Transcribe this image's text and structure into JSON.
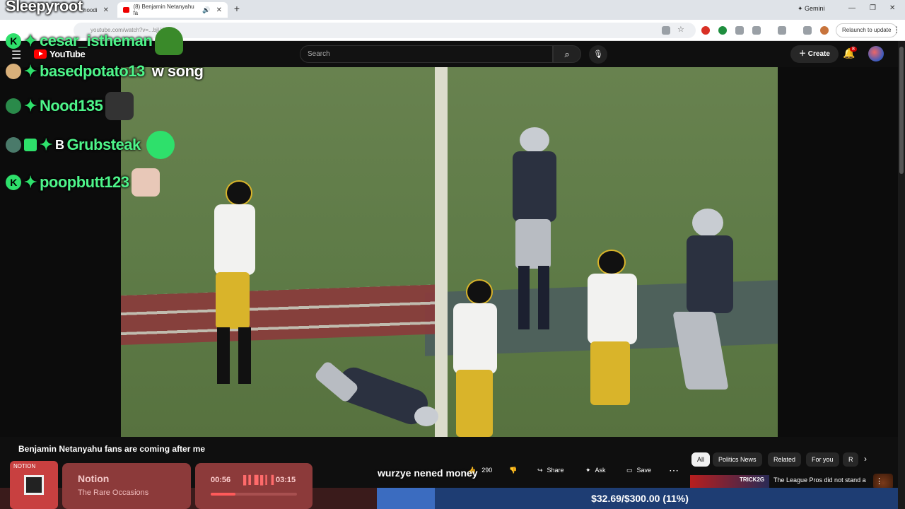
{
  "browser": {
    "tabs": [
      {
        "label": "hoodi",
        "active": false
      },
      {
        "label": "(8) Benjamin Netanyahu fa",
        "active": true
      }
    ],
    "url": "youtube.com/watch?v=...bjU/",
    "gemini_label": "Gemini",
    "relaunch_label": "Relaunch to update"
  },
  "youtube": {
    "logo_text": "YouTube",
    "search_placeholder": "Search",
    "create_label": "Create",
    "notification_count": "8",
    "video_title": "Benjamin Netanyahu fans are coming after me",
    "likes": "290",
    "share_label": "Share",
    "ask_label": "Ask",
    "save_label": "Save",
    "chips": [
      "All",
      "Politics News",
      "Related",
      "For you",
      "R"
    ],
    "recommendation": {
      "title": "The League Pros did not stand a",
      "thumb_text": "TRICK2G"
    }
  },
  "overlay": {
    "streamer": "Sleepyroot",
    "chat": [
      {
        "user": "cesar_istheman",
        "message": ""
      },
      {
        "user": "basedpotato13",
        "message": "w song"
      },
      {
        "user": "Nood135",
        "message": ""
      },
      {
        "user": "Grubsteak",
        "message": "",
        "prefix": "B"
      },
      {
        "user": "poopbutt123",
        "message": ""
      }
    ],
    "caption": "wurzye nened money"
  },
  "now_playing": {
    "label": "NOTION",
    "title": "Notion",
    "artist": "The Rare Occasions",
    "elapsed": "00:56",
    "duration": "03:15",
    "progress": 0.29
  },
  "goal": {
    "text": "$32.69/$300.00 (11%)",
    "fraction": 0.11
  },
  "colors": {
    "chat_name": "#4ef58a",
    "badge_green": "#2ee06b",
    "goal_bg": "#1e3d73",
    "goal_fill": "#3b6cc0",
    "widget_bg": "#8c3a3a"
  }
}
